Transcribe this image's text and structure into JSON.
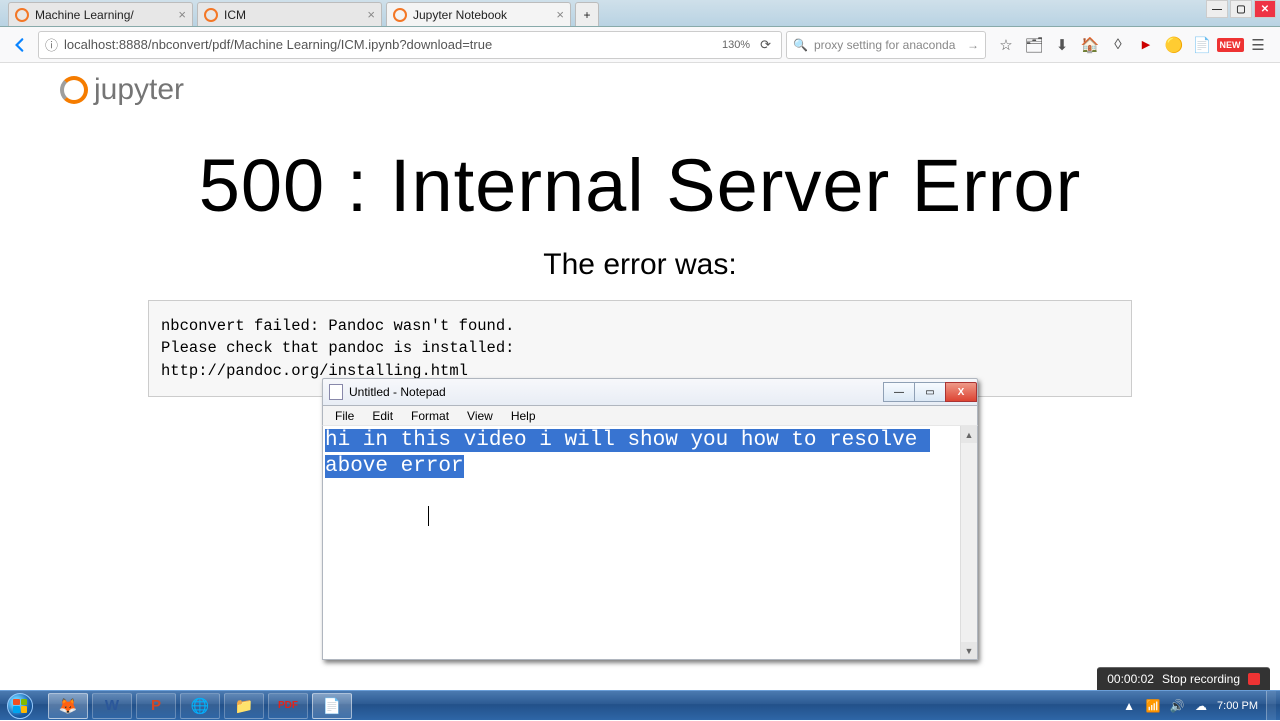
{
  "browser": {
    "tabs": [
      {
        "title": "Machine Learning/"
      },
      {
        "title": "ICM"
      },
      {
        "title": "Jupyter Notebook"
      }
    ],
    "url": "localhost:8888/nbconvert/pdf/Machine Learning/ICM.ipynb?download=true",
    "zoom": "130%",
    "search_placeholder": "proxy setting for anaconda",
    "window_controls": {
      "min": "—",
      "max": "▢",
      "close": "✕"
    },
    "new_badge": "NEW"
  },
  "page": {
    "logo_text": "jupyter",
    "heading": "500 : Internal Server Error",
    "subheading": "The error was:",
    "error_text": "nbconvert failed: Pandoc wasn't found.\nPlease check that pandoc is installed:\nhttp://pandoc.org/installing.html"
  },
  "notepad": {
    "title": "Untitled - Notepad",
    "menus": {
      "file": "File",
      "edit": "Edit",
      "format": "Format",
      "view": "View",
      "help": "Help"
    },
    "selected_text": "hi in this video i will show you how to resolve above error",
    "controls": {
      "min": "—",
      "max": "▭",
      "close": "X"
    }
  },
  "recorder": {
    "time": "00:00:02",
    "label": "Stop recording"
  },
  "tray": {
    "time": "7:00 PM"
  }
}
